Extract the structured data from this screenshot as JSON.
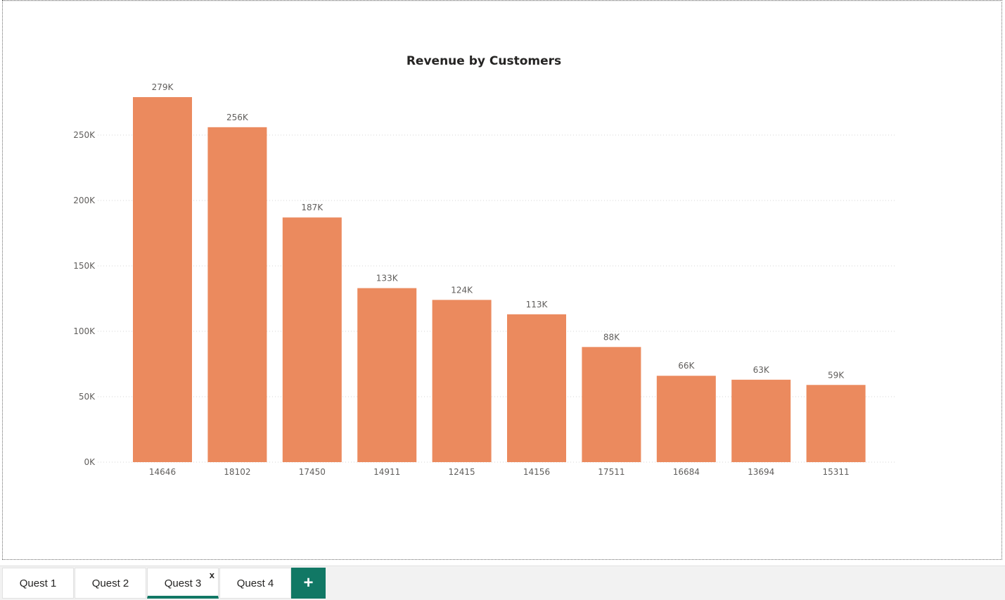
{
  "chart_data": {
    "type": "bar",
    "title": "Revenue by Customers",
    "xlabel": "",
    "ylabel": "",
    "categories": [
      "14646",
      "18102",
      "17450",
      "14911",
      "12415",
      "14156",
      "17511",
      "16684",
      "13694",
      "15311"
    ],
    "values": [
      279000,
      256000,
      187000,
      133000,
      124000,
      113000,
      88000,
      66000,
      63000,
      59000
    ],
    "data_labels": [
      "279K",
      "256K",
      "187K",
      "133K",
      "124K",
      "113K",
      "88K",
      "66K",
      "63K",
      "59K"
    ],
    "y_ticks": [
      0,
      50000,
      100000,
      150000,
      200000,
      250000
    ],
    "y_tick_labels": [
      "0K",
      "50K",
      "100K",
      "150K",
      "200K",
      "250K"
    ],
    "ylim": [
      0,
      280000
    ],
    "grid": true,
    "legend": "none",
    "bar_color": "#EB8A5E"
  },
  "tabs": [
    {
      "label": "Quest 1",
      "active": false
    },
    {
      "label": "Quest 2",
      "active": false
    },
    {
      "label": "Quest 3",
      "active": true
    },
    {
      "label": "Quest 4",
      "active": false
    }
  ],
  "active_tab_close": "x",
  "add_tab_label": "+",
  "colors": {
    "accent": "#117865",
    "tab_underline": "#117865"
  }
}
